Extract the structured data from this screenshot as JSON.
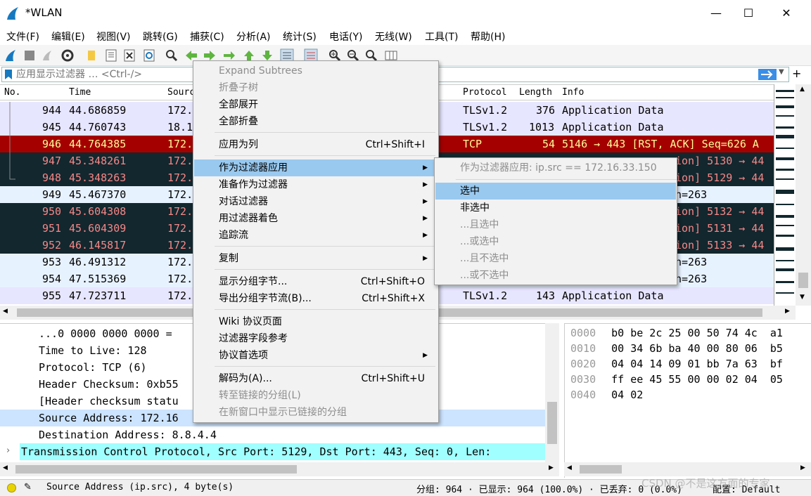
{
  "window": {
    "title": "*WLAN",
    "minimize": "—",
    "maximize": "☐",
    "close": "✕"
  },
  "menubar": [
    "文件(F)",
    "编辑(E)",
    "视图(V)",
    "跳转(G)",
    "捕获(C)",
    "分析(A)",
    "统计(S)",
    "电话(Y)",
    "无线(W)",
    "工具(T)",
    "帮助(H)"
  ],
  "filter": {
    "placeholder": "应用显示过滤器 … <Ctrl-/>"
  },
  "packet_list": {
    "headers": {
      "no": "No.",
      "time": "Time",
      "source": "Source",
      "protocol": "Protocol",
      "length": "Length",
      "info": "Info"
    },
    "rows": [
      {
        "no": "944",
        "time": "44.686859",
        "src": "172.",
        "proto": "TLSv1.2",
        "len": "376",
        "info": "Application Data"
      },
      {
        "no": "945",
        "time": "44.760743",
        "src": "18.1",
        "proto": "TLSv1.2",
        "len": "1013",
        "info": "Application Data"
      },
      {
        "no": "946",
        "time": "44.764385",
        "src": "172.",
        "proto": "TCP",
        "len": "54",
        "info": "5146 → 443 [RST, ACK] Seq=626 A"
      },
      {
        "no": "947",
        "time": "45.348261",
        "src": "172.",
        "proto": "",
        "len": "",
        "info": "ion] 5130 → 44"
      },
      {
        "no": "948",
        "time": "45.348263",
        "src": "172.",
        "proto": "",
        "len": "",
        "info": "ion] 5129 → 44"
      },
      {
        "no": "949",
        "time": "45.467370",
        "src": "172.",
        "proto": "",
        "len": "",
        "info": "n=263"
      },
      {
        "no": "950",
        "time": "45.604308",
        "src": "172.",
        "proto": "",
        "len": "",
        "info": "ion] 5132 → 44"
      },
      {
        "no": "951",
        "time": "45.604309",
        "src": "172.",
        "proto": "",
        "len": "",
        "info": "ion] 5131 → 44"
      },
      {
        "no": "952",
        "time": "46.145817",
        "src": "172.",
        "proto": "",
        "len": "",
        "info": "ion] 5133 → 44"
      },
      {
        "no": "953",
        "time": "46.491312",
        "src": "172.",
        "proto": "",
        "len": "",
        "info": "n=263"
      },
      {
        "no": "954",
        "time": "47.515369",
        "src": "172.",
        "proto": "",
        "len": "",
        "info": "n=263"
      },
      {
        "no": "955",
        "time": "47.723711",
        "src": "172.",
        "proto": "TLSv1.2",
        "len": "143",
        "info": "Application Data"
      }
    ]
  },
  "details": [
    "...0 0000 0000 0000 =",
    "Time to Live: 128",
    "Protocol: TCP (6)",
    "Header Checksum: 0xb55",
    "[Header checksum statu",
    "Source Address: 172.16",
    "Destination Address: 8.8.4.4",
    "Transmission Control Protocol, Src Port: 5129, Dst Port: 443, Seq: 0, Len:"
  ],
  "bytes": [
    {
      "offset": "0000",
      "hex": "b0 be 2c 25 00 50 74 4c  a1"
    },
    {
      "offset": "0010",
      "hex": "00 34 6b ba 40 00 80 06  b5"
    },
    {
      "offset": "0020",
      "hex": "04 04 14 09 01 bb 7a 63  bf"
    },
    {
      "offset": "0030",
      "hex": "ff ee 45 55 00 00 02 04  05"
    },
    {
      "offset": "0040",
      "hex": "04 02"
    }
  ],
  "context_menu": {
    "items": [
      {
        "label": "Expand Subtrees",
        "shortcut": "",
        "disabled": true
      },
      {
        "label": "折叠子树",
        "shortcut": "",
        "disabled": true
      },
      {
        "label": "全部展开",
        "shortcut": ""
      },
      {
        "label": "全部折叠",
        "shortcut": ""
      },
      {
        "label": "应用为列",
        "shortcut": "Ctrl+Shift+I"
      },
      {
        "label": "作为过滤器应用",
        "shortcut": "",
        "submenu": true,
        "highlighted": true
      },
      {
        "label": "准备作为过滤器",
        "shortcut": "",
        "submenu": true
      },
      {
        "label": "对话过滤器",
        "shortcut": "",
        "submenu": true
      },
      {
        "label": "用过滤器着色",
        "shortcut": "",
        "submenu": true
      },
      {
        "label": "追踪流",
        "shortcut": "",
        "submenu": true
      },
      {
        "label": "复制",
        "shortcut": "",
        "submenu": true
      },
      {
        "label": "显示分组字节...",
        "shortcut": "Ctrl+Shift+O"
      },
      {
        "label": "导出分组字节流(B)...",
        "shortcut": "Ctrl+Shift+X"
      },
      {
        "label": "Wiki 协议页面",
        "shortcut": ""
      },
      {
        "label": "过滤器字段参考",
        "shortcut": ""
      },
      {
        "label": "协议首选项",
        "shortcut": "",
        "submenu": true
      },
      {
        "label": "解码为(A)...",
        "shortcut": "Ctrl+Shift+U"
      },
      {
        "label": "转至链接的分组(L)",
        "shortcut": "",
        "disabled": true
      },
      {
        "label": "在新窗口中显示已链接的分组",
        "shortcut": "",
        "disabled": true
      }
    ]
  },
  "submenu": {
    "header": "作为过滤器应用: ip.src == 172.16.33.150",
    "items": [
      {
        "label": "选中",
        "highlighted": true
      },
      {
        "label": "非选中"
      },
      {
        "label": "...且选中",
        "disabled": true
      },
      {
        "label": "...或选中",
        "disabled": true
      },
      {
        "label": "...且不选中",
        "disabled": true
      },
      {
        "label": "...或不选中",
        "disabled": true
      }
    ]
  },
  "status": {
    "field": "Source Address (ip.src), 4 byte(s)",
    "packets": "分组: 964 · 已显示: 964 (100.0%) · 已丢弃: 0 (0.0%)",
    "profile": "配置: Default",
    "watermark": "CSDN @不是这方面的专家"
  },
  "colors": {
    "tls_row": "#e7e6ff",
    "rst_row": "#a40000",
    "dark_row": "#12272e",
    "ack_row": "#e7f2ff",
    "dark_text": "#f78787",
    "selected": "#cce4ff",
    "tcp_details": "#a0ffff",
    "menu_highlight": "#99c9ef"
  }
}
